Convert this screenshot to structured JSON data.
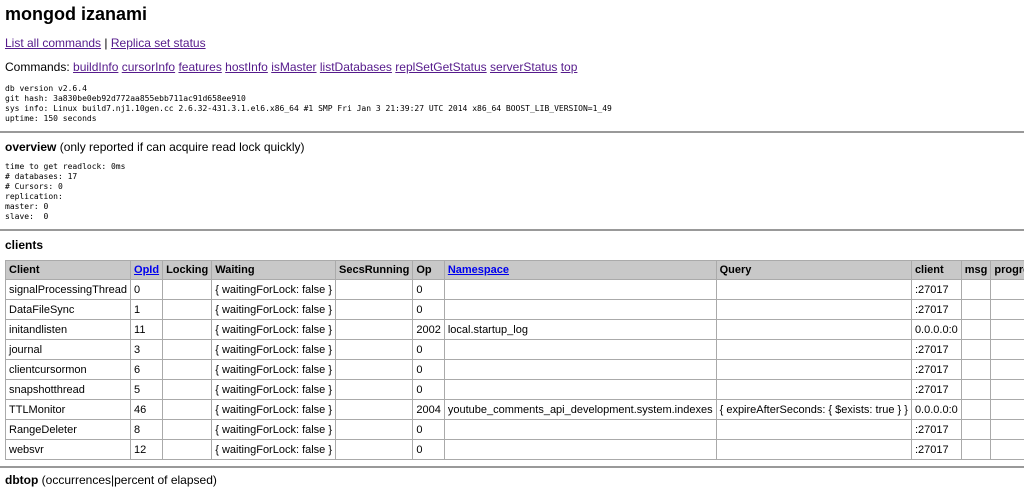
{
  "title": "mongod izanami",
  "links": [
    {
      "label": "List all commands"
    },
    {
      "label": "Replica set status"
    }
  ],
  "separator": "|",
  "commands_label": "Commands:",
  "commands": [
    "buildInfo",
    "cursorInfo",
    "features",
    "hostInfo",
    "isMaster",
    "listDatabases",
    "replSetGetStatus",
    "serverStatus",
    "top"
  ],
  "version_info": "db version v2.6.4\ngit hash: 3a830be0eb92d772aa855ebb711ac91d658ee910\nsys info: Linux build7.nj1.10gen.cc 2.6.32-431.3.1.el6.x86_64 #1 SMP Fri Jan 3 21:39:27 UTC 2014 x86_64 BOOST_LIB_VERSION=1_49\nuptime: 150 seconds",
  "overview": {
    "title": "overview",
    "note": " (only reported if can acquire read lock quickly)",
    "body": "time to get readlock: 0ms\n# databases: 17\n# Cursors: 0\nreplication:\nmaster: 0\nslave:  0"
  },
  "clients": {
    "title": "clients",
    "columns": [
      "Client",
      "OpId",
      "Locking",
      "Waiting",
      "SecsRunning",
      "Op",
      "Namespace",
      "Query",
      "client",
      "msg",
      "progress"
    ],
    "rows": [
      [
        "signalProcessingThread",
        "0",
        "",
        "{ waitingForLock: false }",
        "",
        "0",
        "",
        "",
        ":27017",
        "",
        ""
      ],
      [
        "DataFileSync",
        "1",
        "",
        "{ waitingForLock: false }",
        "",
        "0",
        "",
        "",
        ":27017",
        "",
        ""
      ],
      [
        "initandlisten",
        "11",
        "",
        "{ waitingForLock: false }",
        "",
        "2002",
        "local.startup_log",
        "",
        "0.0.0.0:0",
        "",
        ""
      ],
      [
        "journal",
        "3",
        "",
        "{ waitingForLock: false }",
        "",
        "0",
        "",
        "",
        ":27017",
        "",
        ""
      ],
      [
        "clientcursormon",
        "6",
        "",
        "{ waitingForLock: false }",
        "",
        "0",
        "",
        "",
        ":27017",
        "",
        ""
      ],
      [
        "snapshotthread",
        "5",
        "",
        "{ waitingForLock: false }",
        "",
        "0",
        "",
        "",
        ":27017",
        "",
        ""
      ],
      [
        "TTLMonitor",
        "46",
        "",
        "{ waitingForLock: false }",
        "",
        "2004",
        "youtube_comments_api_development.system.indexes",
        "{ expireAfterSeconds: { $exists: true } }",
        "0.0.0.0:0",
        "",
        ""
      ],
      [
        "RangeDeleter",
        "8",
        "",
        "{ waitingForLock: false }",
        "",
        "0",
        "",
        "",
        ":27017",
        "",
        ""
      ],
      [
        "websvr",
        "12",
        "",
        "{ waitingForLock: false }",
        "",
        "0",
        "",
        "",
        ":27017",
        "",
        ""
      ]
    ]
  },
  "dbtop": {
    "title": "dbtop",
    "note": " (occurrences|percent of elapsed)"
  }
}
